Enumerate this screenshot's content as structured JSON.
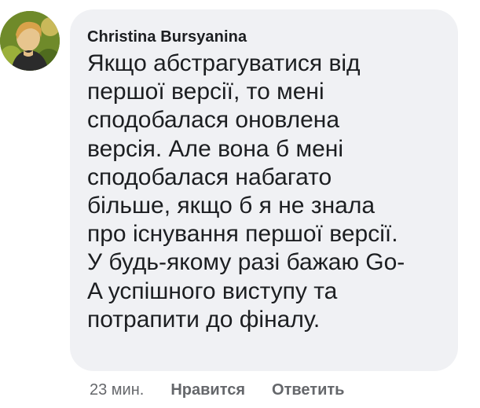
{
  "comment": {
    "author": "Christina Bursyanina",
    "text": "Якщо абстрагуватися від\nпершої версії, то мені\nсподобалася оновлена\nверсія. Але вона б мені\nсподобалася набагато\nбільше, якщо б я не знала\nпро існування першої версії.\nУ будь-якому разі бажаю Go-\nA успішного виступу та\nпотрапити до фіналу.",
    "time": "23 мин.",
    "like_label": "Нравится",
    "reply_label": "Ответить"
  },
  "colors": {
    "bubble": "#f0f1f4",
    "text": "#1c1e21",
    "meta": "#65676b"
  }
}
